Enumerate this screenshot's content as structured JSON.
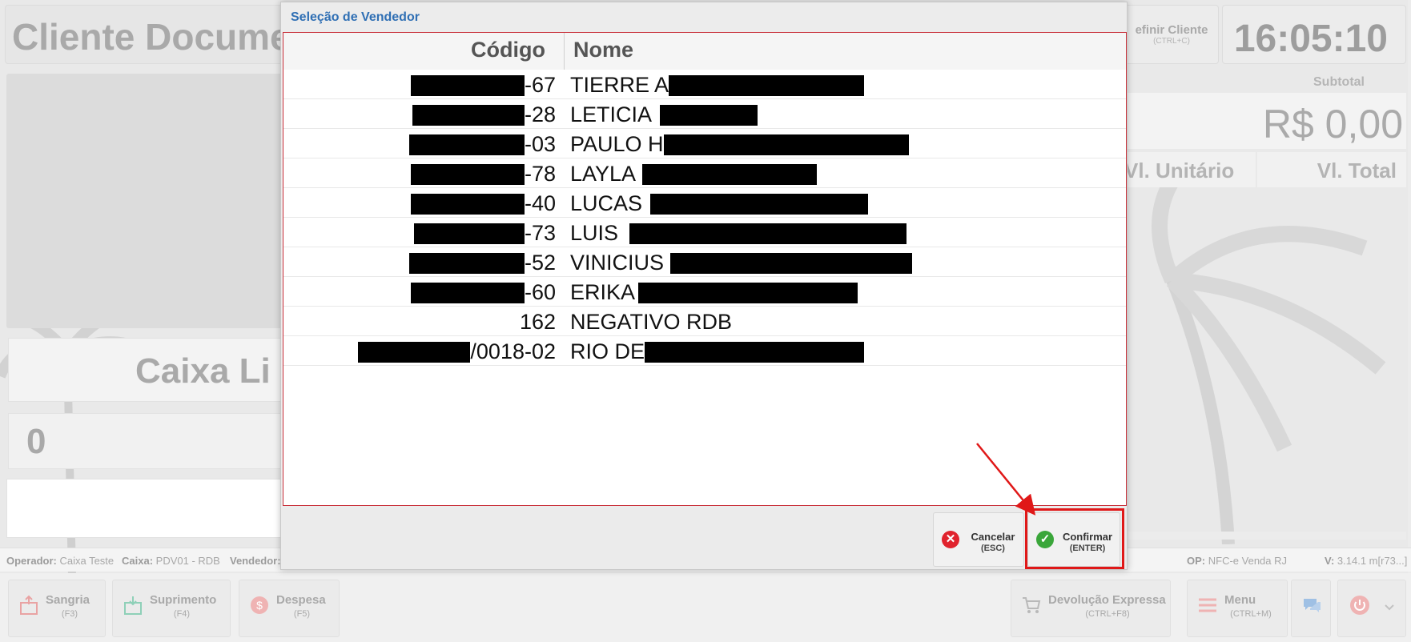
{
  "background": {
    "client_title": "Cliente Docume",
    "definir_label": "efinir Cliente",
    "definir_shortcut": "(CTRL+C)",
    "clock": "16:05:10",
    "subtotal_label": "Subtotal",
    "subtotal_value": "R$ 0,00",
    "col_unit": "Vl. Unitário",
    "col_total": "Vl. Total",
    "caixa_status": "Caixa Li",
    "item_count": "0"
  },
  "status_bar": {
    "operador_label": "Operador:",
    "operador_value": "Caixa Teste",
    "caixa_label": "Caixa:",
    "caixa_value": "PDV01 - RDB",
    "vendedor_label": "Vendedor:",
    "op_label": "OP:",
    "op_value": "NFC-e Venda RJ",
    "version_label": "V:",
    "version_value": "3.14.1 m[r73...]"
  },
  "footer": {
    "buttons": [
      {
        "label": "Sangria",
        "shortcut": "(F3)",
        "icon": "cash-out-icon"
      },
      {
        "label": "Suprimento",
        "shortcut": "(F4)",
        "icon": "cash-in-icon"
      },
      {
        "label": "Despesa",
        "shortcut": "(F5)",
        "icon": "coin-icon"
      },
      {
        "label": "Devolução Expressa",
        "shortcut": "(CTRL+F8)",
        "icon": "cart-icon"
      },
      {
        "label": "Menu",
        "shortcut": "(CTRL+M)",
        "icon": "hamburger-icon"
      }
    ]
  },
  "modal": {
    "title": "Seleção de Vendedor",
    "columns": {
      "codigo": "Código",
      "nome": "Nome"
    },
    "rows": [
      {
        "codigo_suffix": "-67",
        "nome": "TIERRE A"
      },
      {
        "codigo_suffix": "-28",
        "nome": "LETICIA"
      },
      {
        "codigo_suffix": "-03",
        "nome": "PAULO H"
      },
      {
        "codigo_suffix": "-78",
        "nome": "LAYLA"
      },
      {
        "codigo_suffix": "-40",
        "nome": "LUCAS"
      },
      {
        "codigo_suffix": "-73",
        "nome": "LUIS"
      },
      {
        "codigo_suffix": "-52",
        "nome": "VINICIUS"
      },
      {
        "codigo_suffix": "-60",
        "nome": "ERIKA"
      },
      {
        "codigo_suffix": "162",
        "nome": "NEGATIVO RDB"
      },
      {
        "codigo_suffix": "/0018-02",
        "nome": "RIO DE"
      }
    ],
    "cancel_label": "Cancelar",
    "cancel_shortcut": "(ESC)",
    "confirm_label": "Confirmar",
    "confirm_shortcut": "(ENTER)"
  },
  "colors": {
    "accent_blue": "#2f6fb4",
    "highlight_red": "#e01818",
    "cancel_red": "#e0232d",
    "confirm_green": "#3aa63a"
  }
}
